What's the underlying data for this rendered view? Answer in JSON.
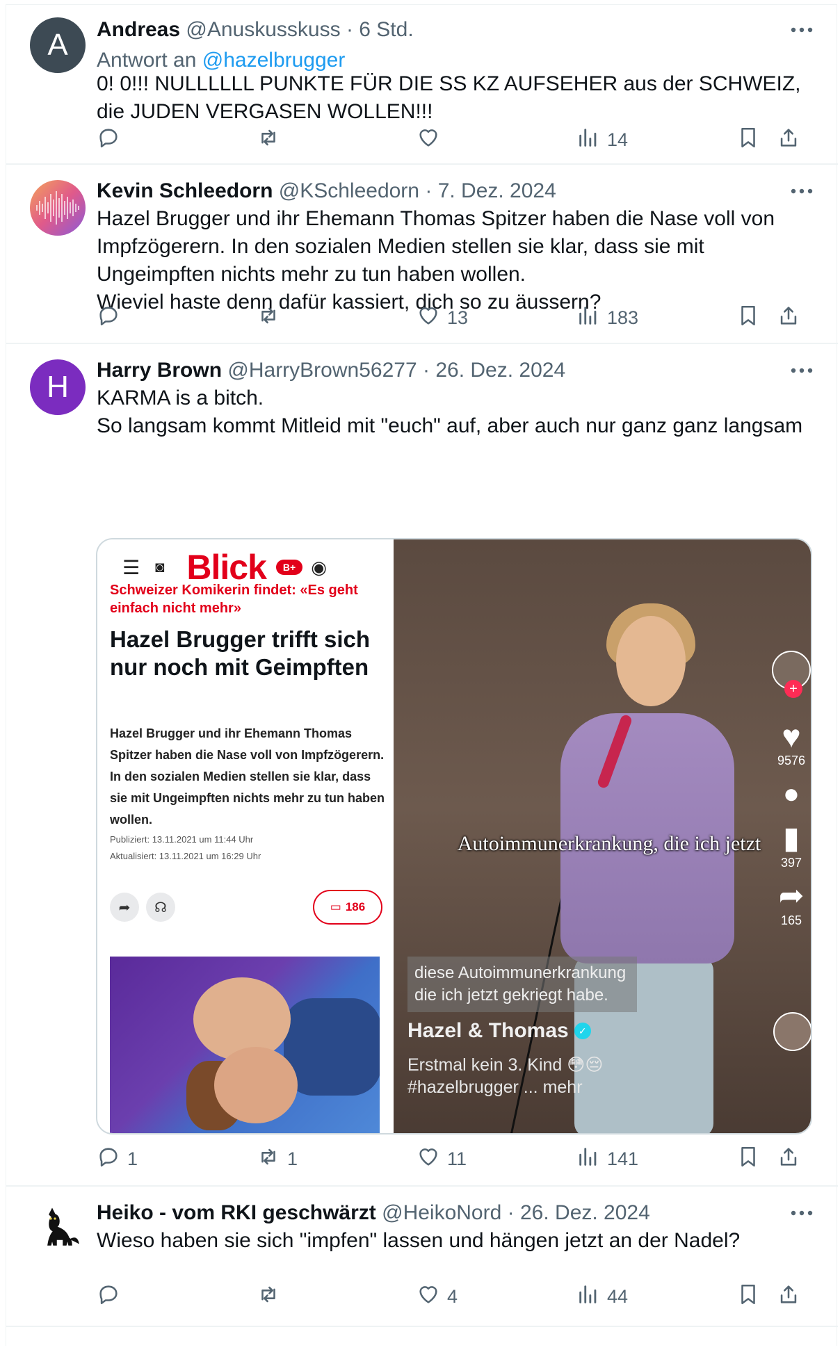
{
  "tweets": [
    {
      "name": "Andreas",
      "handle": "@Anuskusskuss",
      "sep": "·",
      "time": "6 Std.",
      "avatar_letter": "A",
      "avatar_color": "#3d4a54",
      "reply_prefix": "Antwort an",
      "reply_mention": "@hazelbrugger",
      "text": "0! 0!!! NULLLLLL PUNKTE FÜR DIE SS KZ AUFSEHER aus der SCHWEIZ, die JUDEN VERGASEN WOLLEN!!!",
      "replies": "",
      "retweets": "",
      "likes": "",
      "views": "14"
    },
    {
      "name": "Kevin Schleedorn",
      "handle": "@KSchleedorn",
      "sep": "·",
      "time": "7. Dez. 2024",
      "text": "Hazel Brugger und ihr Ehemann Thomas Spitzer haben die Nase voll von Impfzögerern. In den sozialen Medien stellen sie klar, dass sie mit Ungeimpften nichts mehr zu tun haben wollen.\nWieviel haste denn dafür kassiert, dich so zu äussern?",
      "replies": "",
      "retweets": "",
      "likes": "13",
      "views": "183"
    },
    {
      "name": "Harry Brown",
      "handle": "@HarryBrown56277",
      "sep": "·",
      "time": "26. Dez. 2024",
      "avatar_letter": "H",
      "avatar_color": "#7b2cbf",
      "text": "KARMA is a bitch.\nSo langsam kommt Mitleid mit \"euch\" auf, aber auch nur ganz ganz langsam",
      "replies": "1",
      "retweets": "1",
      "likes": "11",
      "views": "141"
    },
    {
      "name": "Heiko - vom RKI geschwärzt",
      "handle": "@HeikoNord",
      "sep": "·",
      "time": "26. Dez. 2024",
      "text": "Wieso haben sie sich \"impfen\" lassen und hängen jetzt an der Nadel?",
      "replies": "",
      "retweets": "",
      "likes": "4",
      "views": "44"
    }
  ],
  "media": {
    "blick": {
      "logo": "Blick",
      "badge": "B+",
      "kicker": "Schweizer Komikerin findet: «Es geht einfach nicht mehr»",
      "headline": "Hazel Brugger trifft sich nur noch mit Geimpften",
      "lead": "Hazel Brugger und ihr Ehemann Thomas Spitzer haben die Nase voll von Impfzögerern. In den sozialen Medien stellen sie klar, dass sie mit Ungeimpften nichts mehr zu tun haben wollen.",
      "published": "Publiziert: 13.11.2021 um 11:44 Uhr",
      "updated": "Aktualisiert: 13.11.2021 um 16:29 Uhr",
      "comments": "186",
      "accent": "#e2001a"
    },
    "video": {
      "caption": "Autoimmunerkrankung, die ich jetzt",
      "subtitle": "diese Autoimmunerkrankung die ich jetzt gekriegt habe.",
      "user": "Hazel & Thomas",
      "desc_line1": "Erstmal kein 3. Kind 😳😔",
      "desc_line2": "#hazelbrugger ... mehr",
      "likes": "9576",
      "saves": "397",
      "shares": "165"
    }
  },
  "colors": {
    "text": "#0f1419",
    "muted": "#536471",
    "link": "#1d9bf0",
    "border": "#eff3f4"
  }
}
